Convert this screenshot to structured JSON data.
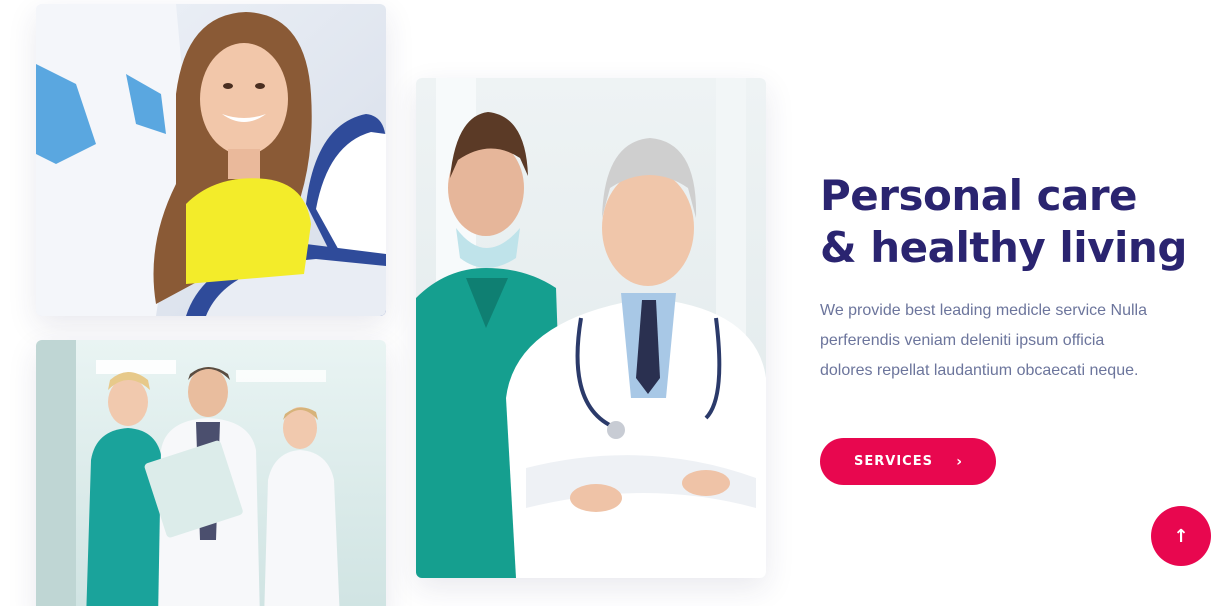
{
  "hero": {
    "headline_line1": "Personal care",
    "headline_line2": "& healthy living",
    "description": "We provide best leading medicle service Nulla perferendis veniam deleniti ipsum officia dolores repellat laudantium obcaecati neque.",
    "services_button": "SERVICES",
    "services_icon": "chevron-right-icon",
    "services_icon_glyph": "›"
  },
  "images": {
    "dental": "photo-smiling-patient-dental-chair",
    "team": "photo-medical-team-walking-corridor",
    "doctors": "photo-two-doctors-portrait"
  },
  "scroll_top": {
    "icon": "arrow-up-icon",
    "glyph": "↑"
  },
  "colors": {
    "accent": "#e8074f",
    "heading": "#2a2470",
    "body_text": "#6c759c"
  }
}
